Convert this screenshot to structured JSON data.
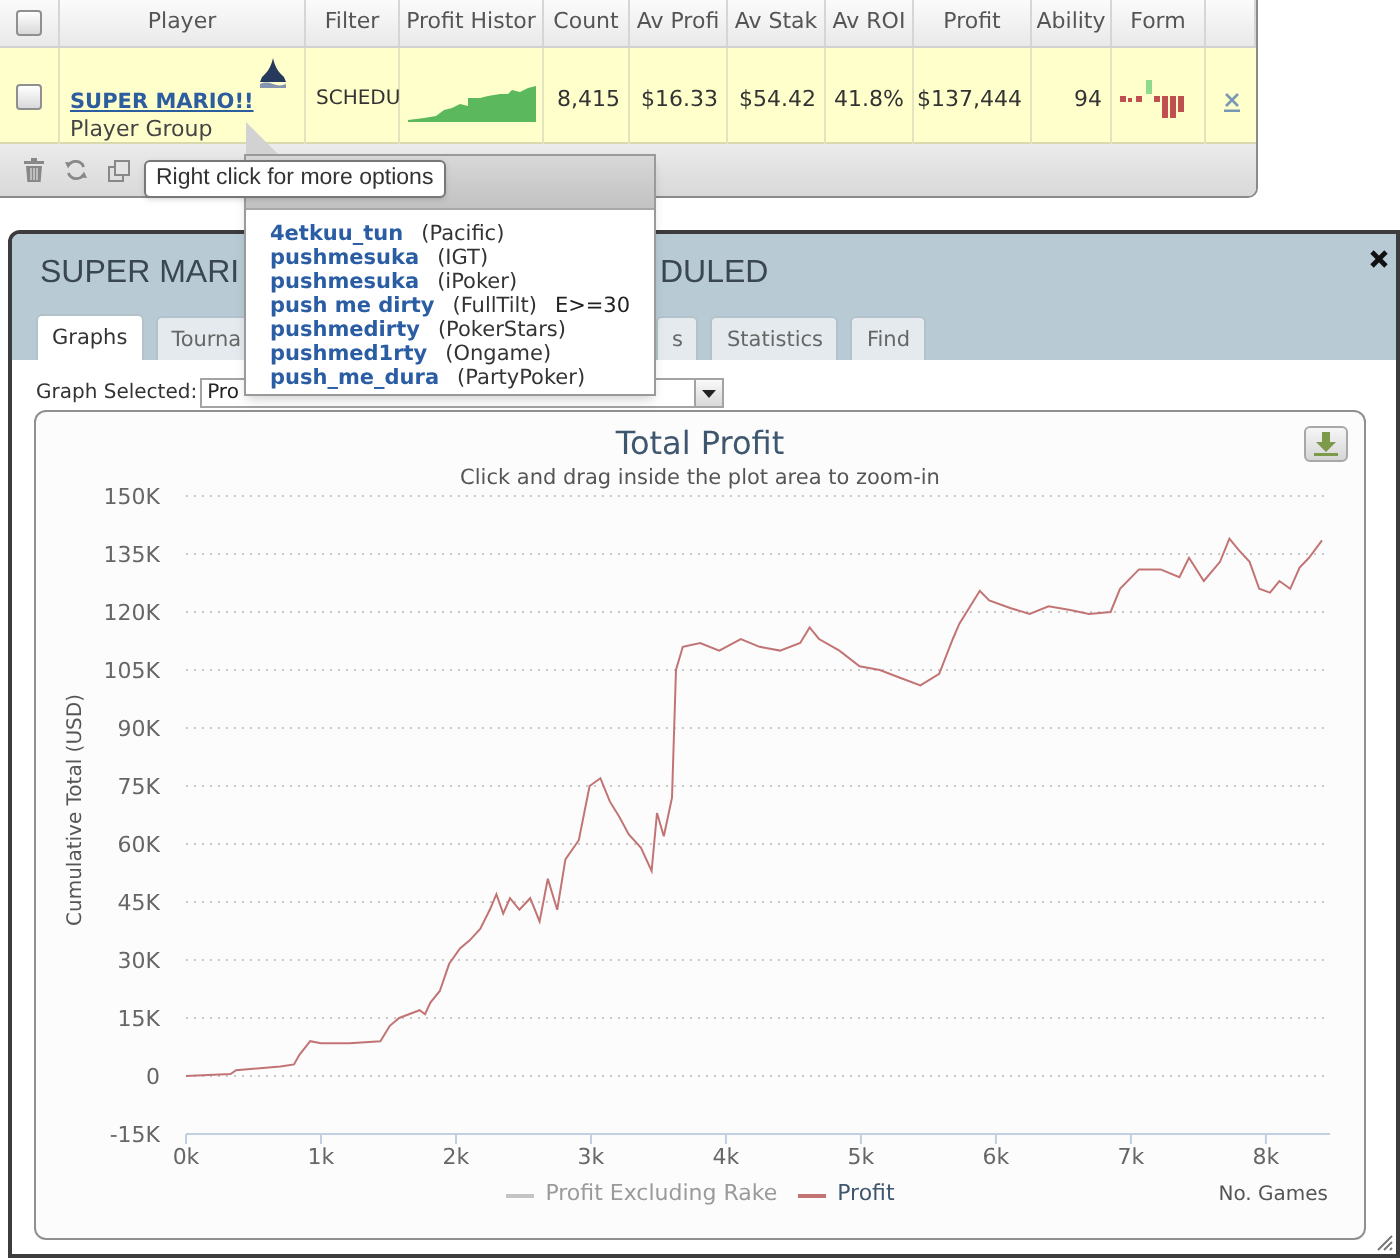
{
  "player_table": {
    "header_checkbox": {
      "checked": false
    },
    "columns": [
      "Player",
      "Filter",
      "Profit Histor",
      "Count",
      "Av Profi",
      "Av Stak",
      "Av ROI",
      "Profit",
      "Ability",
      "Form"
    ],
    "rows": [
      {
        "checked": false,
        "highlighted": true,
        "player": "SUPER MARIO!!",
        "player_type": "Player Group",
        "filter": "SCHEDU",
        "count": "8,415",
        "av_profit": "$16.33",
        "av_stake": "$54.42",
        "av_roi": "41.8%",
        "profit": "$137,444",
        "ability": "94"
      }
    ]
  },
  "tooltip": {
    "text": "Right click for more options"
  },
  "group_popup": {
    "members": [
      {
        "name": "4etkuu_tun",
        "network": "(Pacific)"
      },
      {
        "name": "pushmesuka",
        "network": "(IGT)"
      },
      {
        "name": "pushmesuka",
        "network": "(iPoker)"
      },
      {
        "name": "push me dirty",
        "network": "(FullTilt)",
        "note": "E>=30"
      },
      {
        "name": "pushmedirty",
        "network": "(PokerStars)"
      },
      {
        "name": "pushmed1rty",
        "network": "(Ongame)"
      },
      {
        "name": "push_me_dura",
        "network": "(PartyPoker)"
      }
    ]
  },
  "window": {
    "title_fragments": [
      "SUPER MARI",
      "DULED"
    ],
    "tabs": [
      {
        "label": "Graphs",
        "selected": true
      },
      {
        "label": "Tourna",
        "selected": false
      },
      {
        "label": "s",
        "selected": false
      },
      {
        "label": "Statistics",
        "selected": false
      },
      {
        "label": "Find",
        "selected": false
      }
    ],
    "graph_selector": {
      "label": "Graph Selected:",
      "value": "Pro"
    }
  },
  "chart": {
    "subtitle": "Click and drag inside the plot area to zoom-in",
    "legend": [
      {
        "label": "Profit Excluding Rake",
        "visible": false
      },
      {
        "visible": true
      }
    ],
    "chart_data": {
      "type": "line",
      "title": "Total Profit",
      "xlabel": "No. Games",
      "ylabel": "Cumulative Total (USD)",
      "grid": true,
      "x": [
        0,
        330,
        370,
        700,
        800,
        840,
        920,
        1000,
        1210,
        1440,
        1510,
        1580,
        1730,
        1770,
        1810,
        1880,
        1950,
        2030,
        2100,
        2180,
        2250,
        2300,
        2350,
        2400,
        2470,
        2550,
        2620,
        2680,
        2750,
        2810,
        2910,
        2990,
        3070,
        3140,
        3210,
        3280,
        3370,
        3450,
        3490,
        3540,
        3600,
        3630,
        3680,
        3810,
        3950,
        4110,
        4250,
        4400,
        4550,
        4620,
        4690,
        4840,
        4990,
        5140,
        5290,
        5440,
        5580,
        5680,
        5730,
        5880,
        5950,
        6110,
        6250,
        6390,
        6550,
        6690,
        6850,
        6920,
        7060,
        7220,
        7360,
        7430,
        7540,
        7660,
        7730,
        7800,
        7880,
        7950,
        8030,
        8100,
        8180,
        8250,
        8320,
        8415
      ],
      "series": [
        {
          "name": "Profit",
          "color": "#c27474",
          "values": [
            0,
            500,
            1500,
            2500,
            3000,
            5500,
            9000,
            8500,
            8500,
            9000,
            13000,
            15000,
            17000,
            16000,
            19000,
            22000,
            29000,
            33000,
            35000,
            38000,
            43000,
            47000,
            42000,
            46000,
            43000,
            46000,
            40000,
            51000,
            43000,
            56000,
            61000,
            75000,
            77000,
            71000,
            67000,
            62500,
            59000,
            53000,
            68000,
            62000,
            72000,
            105000,
            111000,
            112000,
            110000,
            113000,
            111000,
            110000,
            112000,
            116000,
            113000,
            110000,
            106000,
            105000,
            103000,
            101000,
            104000,
            113000,
            117000,
            125500,
            123000,
            121000,
            119500,
            121500,
            120500,
            119500,
            120000,
            126000,
            131000,
            131000,
            129000,
            134000,
            128000,
            133000,
            139000,
            136000,
            133000,
            126000,
            125000,
            128000,
            126000,
            131500,
            134000,
            138500
          ]
        }
      ],
      "xlim": [
        0,
        8475
      ],
      "ylim": [
        -15000,
        150000
      ],
      "xticks": [
        {
          "value": 0,
          "label": "0k"
        },
        {
          "value": 1000,
          "label": "1k"
        },
        {
          "value": 2000,
          "label": "2k"
        },
        {
          "value": 3000,
          "label": "3k"
        },
        {
          "value": 4000,
          "label": "4k"
        },
        {
          "value": 5000,
          "label": "5k"
        },
        {
          "value": 6000,
          "label": "6k"
        },
        {
          "value": 7000,
          "label": "7k"
        },
        {
          "value": 8000,
          "label": "8k"
        }
      ],
      "yticks": [
        {
          "value": -15000,
          "label": "-15K"
        },
        0,
        {
          "value": 15000,
          "label": "15K"
        },
        {
          "value": 30000,
          "label": "30K"
        },
        {
          "value": 45000,
          "label": "45K"
        },
        {
          "value": 60000,
          "label": "60K"
        },
        {
          "value": 75000,
          "label": "75K"
        },
        {
          "value": 90000,
          "label": "90K"
        },
        {
          "value": 105000,
          "label": "105K"
        },
        {
          "value": 120000,
          "label": "120K"
        },
        {
          "value": 135000,
          "label": "135K"
        },
        {
          "value": 150000,
          "label": "150K"
        }
      ]
    }
  }
}
